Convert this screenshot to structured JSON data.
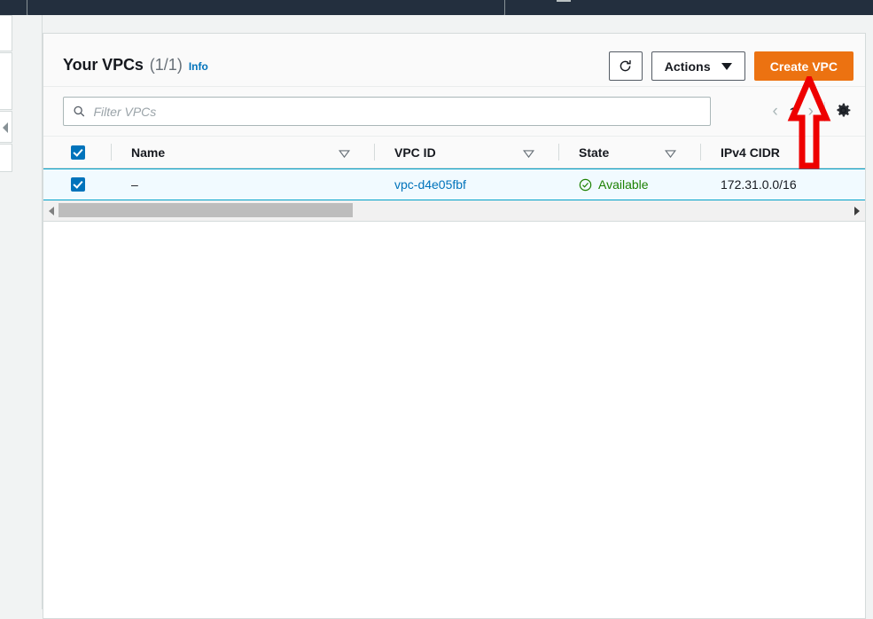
{
  "topnav": {
    "search_placeholder": ""
  },
  "sidebar": {
    "collapse_icon": "chevron-left-icon"
  },
  "panel": {
    "title": "Your VPCs",
    "count": "(1/1)",
    "info_label": "Info",
    "toolbar": {
      "refresh_icon": "refresh-icon",
      "actions_label": "Actions",
      "create_label": "Create VPC"
    },
    "filter": {
      "search_icon": "search-icon",
      "placeholder": "Filter VPCs",
      "value": ""
    },
    "pagination": {
      "prev_icon": "chevron-left-icon",
      "page": "1",
      "next_icon": "chevron-right-icon",
      "settings_icon": "gear-icon"
    },
    "table": {
      "columns": [
        {
          "label": "Name",
          "sortable": true
        },
        {
          "label": "VPC ID",
          "sortable": true
        },
        {
          "label": "State",
          "sortable": true
        },
        {
          "label": "IPv4 CIDR",
          "sortable": false
        }
      ],
      "rows": [
        {
          "selected": true,
          "name": "–",
          "vpc_id": "vpc-d4e05fbf",
          "state": "Available",
          "state_icon": "check-circle-icon",
          "ipv4_cidr": "172.31.0.0/16"
        }
      ]
    }
  },
  "annotation": {
    "arrow_icon": "up-arrow-annotation",
    "color": "#ee0000"
  },
  "colors": {
    "accent_orange": "#ec7211",
    "link_blue": "#0073bb",
    "selected_row_bg": "#f1faff",
    "selected_row_border": "#00a1c9",
    "state_green": "#1d8102",
    "nav_dark": "#232f3e"
  }
}
